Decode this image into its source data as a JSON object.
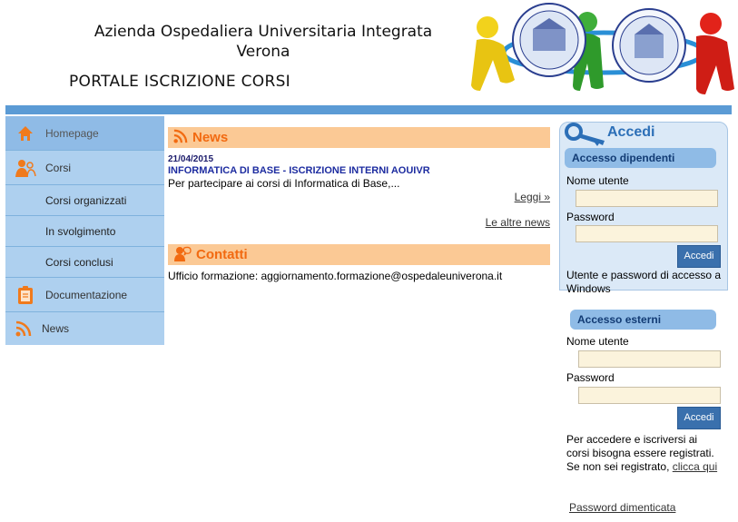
{
  "header": {
    "org_line1": "Azienda Ospedaliera Universitaria Integrata",
    "org_line2": "Verona",
    "portal_title": "PORTALE ISCRIZIONE CORSI",
    "seal1_text": "AZIENDA OSPEDALIERA",
    "seal2_text": "UNIVERSITÀ DEGLI STUDI DI VERONA"
  },
  "sidebar": {
    "items": [
      {
        "label": "Homepage",
        "icon": "home-icon"
      },
      {
        "label": "Corsi",
        "icon": "users-icon"
      },
      {
        "label": "Corsi organizzati"
      },
      {
        "label": "In svolgimento"
      },
      {
        "label": "Corsi conclusi"
      },
      {
        "label": "Documentazione",
        "icon": "clipboard-icon"
      },
      {
        "label": "News",
        "icon": "rss-icon"
      }
    ]
  },
  "news": {
    "heading": "News",
    "date": "21/04/2015",
    "title": "INFORMATICA DI BASE - ISCRIZIONE INTERNI AOUIVR",
    "summary": "Per partecipare ai corsi di Informatica di Base,...",
    "read_more": "Leggi »",
    "other_news": "Le altre news"
  },
  "contacts": {
    "heading": "Contatti",
    "text": "Ufficio formazione: aggiornamento.formazione@ospedaleuniverona.it"
  },
  "login": {
    "title": "Accedi",
    "employees": {
      "heading": "Accesso dipendenti",
      "user_label": "Nome utente",
      "pass_label": "Password",
      "button": "Accedi",
      "note": "Utente e password di accesso a Windows"
    },
    "external": {
      "heading": "Accesso esterni",
      "user_label": "Nome utente",
      "pass_label": "Password",
      "button": "Accedi",
      "note": "Per accedere e iscriversi ai corsi bisogna essere registrati. Se non sei registrato,",
      "register_link": "clicca qui"
    },
    "forgot": "Password dimenticata"
  },
  "colors": {
    "accent_blue": "#5b9bd5",
    "nav_bg": "#aed0ef",
    "section_head_bg": "#fbc995",
    "section_head_text": "#f26a11",
    "button": "#3a70ad"
  }
}
